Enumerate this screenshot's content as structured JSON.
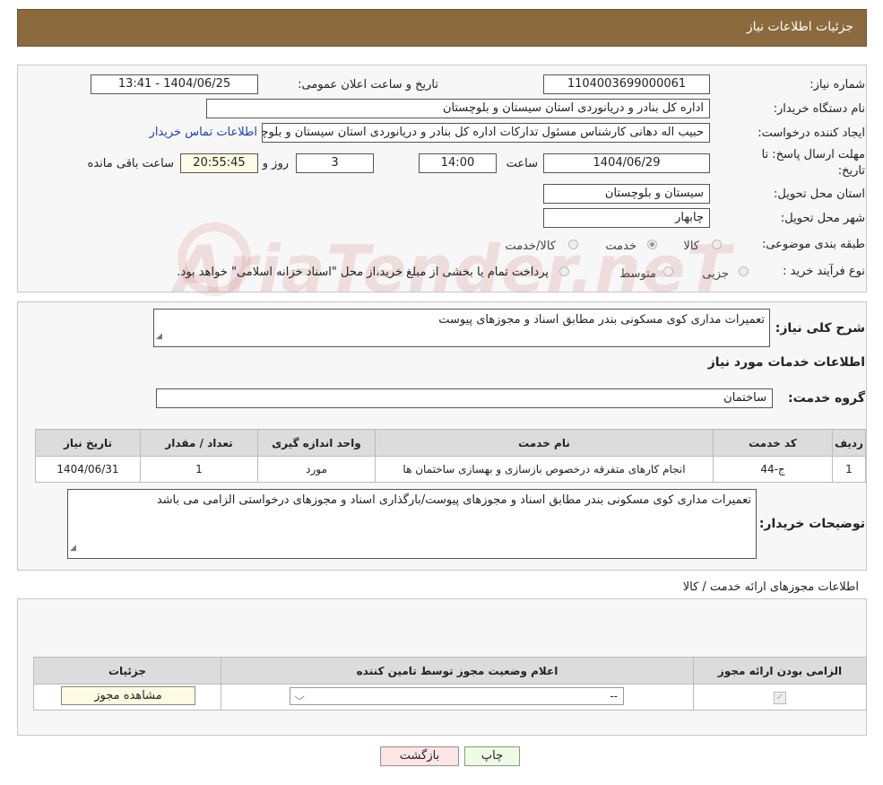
{
  "header": {
    "title": "جزئیات اطلاعات نیاز"
  },
  "form": {
    "need_number_label": "شماره نیاز:",
    "need_number": "1104003699000061",
    "announce_label": "تاریخ و ساعت اعلان عمومی:",
    "announce_value": "1404/06/25 - 13:41",
    "buyer_org_label": "نام دستگاه خریدار:",
    "buyer_org": "اداره کل بنادر و دریانوردی استان سیستان و بلوچستان",
    "requester_label": "ایجاد کننده درخواست:",
    "requester": "حبیب اله دهانی کارشناس مسئول تدارکات اداره کل بنادر و دریانوردی استان سیستان و بلوچستان",
    "contact_link": "اطلاعات تماس خریدار",
    "deadline_label_1": "مهلت ارسال پاسخ: تا",
    "deadline_label_2": "تاریخ:",
    "deadline_date": "1404/06/29",
    "time_label": "ساعت",
    "deadline_time": "14:00",
    "days_value": "3",
    "days_label": "روز و",
    "remaining_time": "20:55:45",
    "remaining_label": "ساعت باقی مانده",
    "province_label": "استان محل تحویل:",
    "province": "سیستان و بلوچستان",
    "city_label": "شهر محل تحویل:",
    "city": "چابهار",
    "category_label": "طبقه بندی موضوعی:",
    "category_options": [
      "کالا",
      "خدمت",
      "کالا/خدمت"
    ],
    "category_selected": "خدمت",
    "process_label": "نوع فرآیند خرید :",
    "process_options": [
      "جزیی",
      "متوسط"
    ],
    "process_note": "پرداخت تمام یا بخشی از مبلغ خرید،از محل \"اسناد خزانه اسلامی\" خواهد بود."
  },
  "summary": {
    "label": "شرح کلی نیاز:",
    "value": "تعمیرات مداری کوی مسکونی بندر مطابق اسناد و مجوزهای پیوست"
  },
  "services": {
    "section_title": "اطلاعات خدمات مورد نیاز",
    "group_label": "گروه خدمت:",
    "group_value": "ساختمان",
    "table": {
      "headers": [
        "ردیف",
        "کد خدمت",
        "نام خدمت",
        "واحد اندازه گیری",
        "تعداد / مقدار",
        "تاریخ نیاز"
      ],
      "rows": [
        [
          "1",
          "ج-44",
          "انجام کارهای متفرقه درخصوص بازسازی و بهسازی ساختمان ها",
          "مورد",
          "1",
          "1404/06/31"
        ]
      ]
    },
    "buyer_notes_label": "توضیحات خریدار:",
    "buyer_notes": "تعمیرات مداری کوی مسکونی بندر مطابق اسناد و مجوزهای پیوست/بارگذاری اسناد و مجوزهای درخواستی الزامی می باشد"
  },
  "permits": {
    "section_title": "اطلاعات مجوزهای ارائه خدمت / کالا",
    "headers": [
      "الزامی بودن ارائه مجوز",
      "اعلام وضعیت مجوز توسط تامین کننده",
      "جزئیات"
    ],
    "select_value": "--",
    "view_button": "مشاهده مجوز"
  },
  "buttons": {
    "print": "چاپ",
    "back": "بازگشت"
  },
  "watermark": {
    "text": "AriaTender.neT"
  }
}
